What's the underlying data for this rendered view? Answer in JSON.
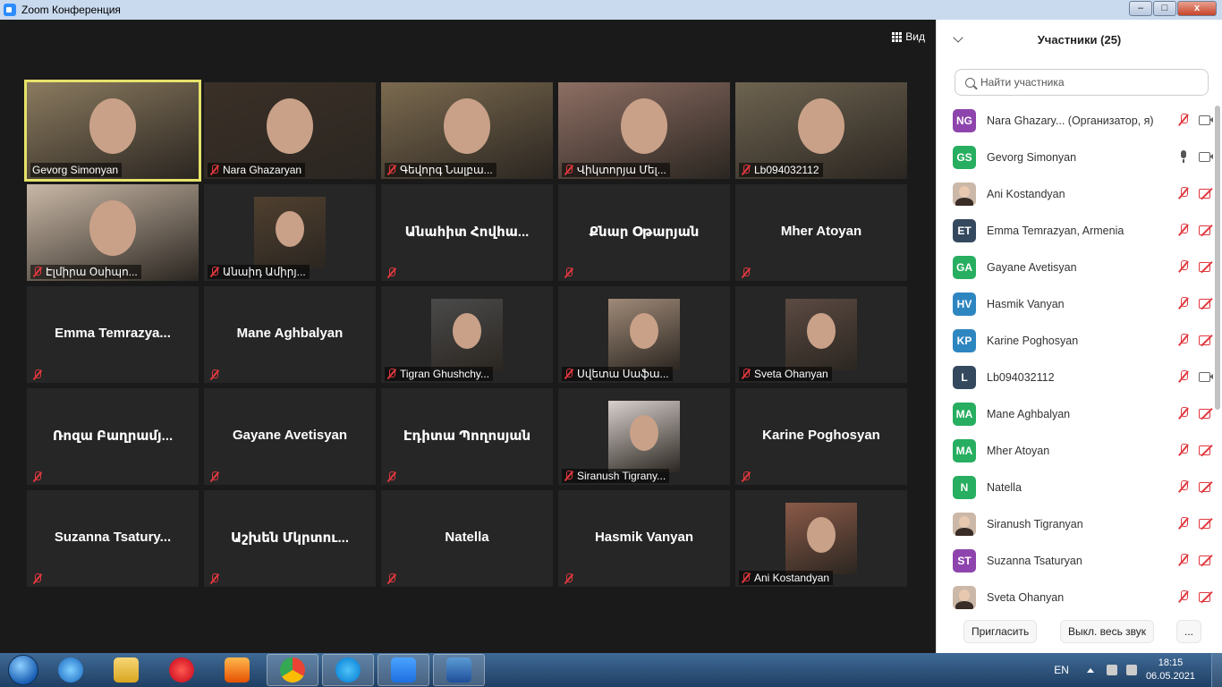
{
  "window": {
    "title": "Zoom Конференция",
    "min": "–",
    "max": "□",
    "close": "x"
  },
  "toolbar": {
    "view_label": "Вид"
  },
  "tiles": [
    {
      "name": "Gevorg Simonyan",
      "video": true,
      "active": true
    },
    {
      "name": "Nara Ghazaryan",
      "video": true
    },
    {
      "name": "Գեվորգ Նալբա...",
      "video": true
    },
    {
      "name": "Վիկտորյա Մել...",
      "video": true
    },
    {
      "name": "Lb094032112",
      "video": true
    },
    {
      "name": "Էլմիրա Օսիպո...",
      "video": true
    },
    {
      "name": "Անաիդ Ամիրյ...",
      "video": true
    },
    {
      "name": "Անահիտ Հովհա...",
      "video": false
    },
    {
      "name": "Քնար Օթարյան",
      "video": false
    },
    {
      "name": "Mher Atoyan",
      "video": false
    },
    {
      "name": "Emma  Temrazya...",
      "video": false
    },
    {
      "name": "Mane Aghbalyan",
      "video": false
    },
    {
      "name": "Tigran Ghushchy...",
      "video": true
    },
    {
      "name": "Սվետա Սաֆա...",
      "video": true
    },
    {
      "name": "Sveta Ohanyan",
      "video": true
    },
    {
      "name": "Ռոզա Բաղրամյ...",
      "video": false
    },
    {
      "name": "Gayane Avetisyan",
      "video": false
    },
    {
      "name": "Էդիտա Պողոսյան",
      "video": false
    },
    {
      "name": "Siranush Tigrany...",
      "video": true
    },
    {
      "name": "Karine Poghosyan",
      "video": false
    },
    {
      "name": "Suzanna  Tsatury...",
      "video": false
    },
    {
      "name": "Աշխեն Մկրտու...",
      "video": false
    },
    {
      "name": "Natella",
      "video": false
    },
    {
      "name": "Hasmik Vanyan",
      "video": false
    },
    {
      "name": "Ani Kostandyan",
      "video": true
    }
  ],
  "panel": {
    "title": "Участники (25)",
    "search_placeholder": "Найти участника",
    "participants": [
      {
        "initials": "NG",
        "color": "#8e44ad",
        "name": "Nara Ghazary...",
        "role": " (Организатор, я)",
        "mic": "off",
        "cam": "on"
      },
      {
        "initials": "GS",
        "color": "#27ae60",
        "name": "Gevorg Simonyan",
        "role": "",
        "mic": "on",
        "cam": "on"
      },
      {
        "initials": "",
        "color": "photo",
        "name": "Ani Kostandyan",
        "role": "",
        "mic": "off",
        "cam": "off"
      },
      {
        "initials": "ET",
        "color": "#34495e",
        "name": "Emma Temrazyan, Armenia",
        "role": "",
        "mic": "off",
        "cam": "off"
      },
      {
        "initials": "GA",
        "color": "#27ae60",
        "name": "Gayane Avetisyan",
        "role": "",
        "mic": "off",
        "cam": "off"
      },
      {
        "initials": "HV",
        "color": "#2e86c1",
        "name": "Hasmik Vanyan",
        "role": "",
        "mic": "off",
        "cam": "off"
      },
      {
        "initials": "KP",
        "color": "#2e86c1",
        "name": "Karine Poghosyan",
        "role": "",
        "mic": "off",
        "cam": "off"
      },
      {
        "initials": "L",
        "color": "#34495e",
        "name": "Lb094032112",
        "role": "",
        "mic": "off",
        "cam": "on"
      },
      {
        "initials": "MA",
        "color": "#27ae60",
        "name": "Mane Aghbalyan",
        "role": "",
        "mic": "off",
        "cam": "off"
      },
      {
        "initials": "MA",
        "color": "#27ae60",
        "name": "Mher Atoyan",
        "role": "",
        "mic": "off",
        "cam": "off"
      },
      {
        "initials": "N",
        "color": "#27ae60",
        "name": "Natella",
        "role": "",
        "mic": "off",
        "cam": "off"
      },
      {
        "initials": "",
        "color": "photo",
        "name": "Siranush Tigranyan",
        "role": "",
        "mic": "off",
        "cam": "off"
      },
      {
        "initials": "ST",
        "color": "#8e44ad",
        "name": "Suzanna Tsaturyan",
        "role": "",
        "mic": "off",
        "cam": "off"
      },
      {
        "initials": "",
        "color": "photo",
        "name": "Sveta Ohanyan",
        "role": "",
        "mic": "off",
        "cam": "off"
      }
    ],
    "invite": "Пригласить",
    "mute_all": "Выкл. весь звук",
    "more": "..."
  },
  "taskbar": {
    "apps": [
      "internet-explorer-icon",
      "file-explorer-icon",
      "yandex-icon",
      "media-player-icon",
      "chrome-icon",
      "skype-icon",
      "zoom-icon",
      "word-icon"
    ],
    "lang": "EN",
    "time": "18:15",
    "date": "06.05.2021"
  }
}
